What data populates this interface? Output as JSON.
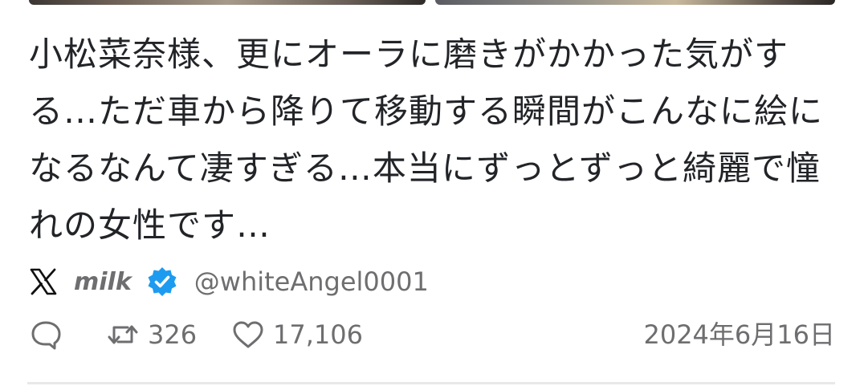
{
  "post": {
    "text": "小松菜奈様、更にオーラに磨きがかかった気がする…ただ車から降りて移動する瞬間がこんなに絵になるなんて凄すぎる…本当にずっとずっと綺麗で憧れの女性です…"
  },
  "author": {
    "platform_icon": "x-logo-icon",
    "name": "milk",
    "verified_icon": "verified-badge-icon",
    "handle": "@whiteAngel0001"
  },
  "actions": {
    "reply_icon": "reply-icon",
    "retweet_icon": "retweet-icon",
    "retweet_count": "326",
    "like_icon": "heart-icon",
    "like_count": "17,106"
  },
  "date": "2024年6月16日",
  "colors": {
    "text": "#222428",
    "muted": "#6e6e70",
    "verified": "#1d9bf0",
    "divider": "#e8e8ea"
  }
}
